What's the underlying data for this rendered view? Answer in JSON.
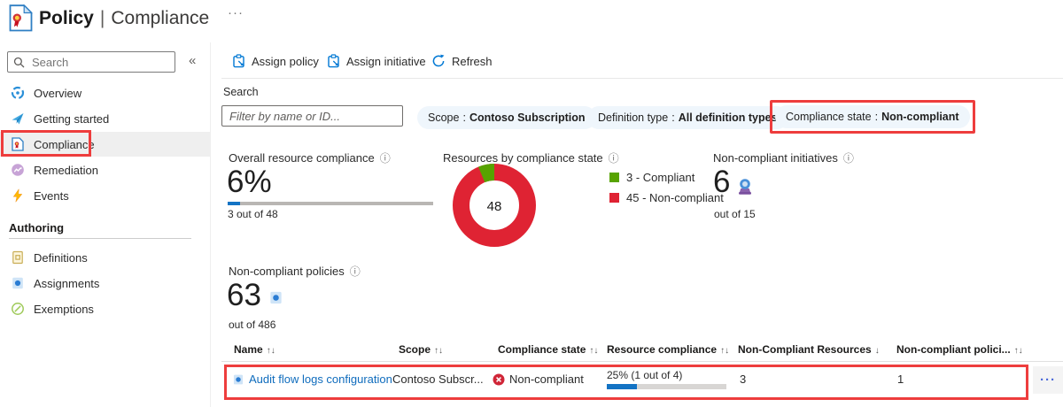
{
  "titlebar": {
    "primary": "Policy",
    "separator": "|",
    "secondary": "Compliance",
    "more": "···"
  },
  "sidebar": {
    "search_placeholder": "Search",
    "collapse": "«",
    "items": [
      {
        "label": "Overview"
      },
      {
        "label": "Getting started"
      },
      {
        "label": "Compliance"
      },
      {
        "label": "Remediation"
      },
      {
        "label": "Events"
      }
    ],
    "authoring": {
      "heading": "Authoring",
      "items": [
        {
          "label": "Definitions"
        },
        {
          "label": "Assignments"
        },
        {
          "label": "Exemptions"
        }
      ]
    }
  },
  "toolbar": {
    "buttons": [
      {
        "label": "Assign policy"
      },
      {
        "label": "Assign initiative"
      },
      {
        "label": "Refresh"
      }
    ]
  },
  "filters": {
    "search_label": "Search",
    "search_placeholder": "Filter by name or ID...",
    "separator": ":",
    "pills": [
      {
        "label": "Scope",
        "value": "Contoso Subscription"
      },
      {
        "label": "Definition type",
        "value": "All definition types"
      },
      {
        "label": "Compliance state",
        "value": "Non-compliant"
      }
    ]
  },
  "stats": {
    "info_icon": "ⓘ",
    "overall": {
      "title": "Overall resource compliance",
      "value": "6%",
      "percent": 6,
      "subtext": "3 out of 48"
    },
    "resources": {
      "title": "Resources by compliance state"
    },
    "initiatives": {
      "title": "Non-compliant initiatives",
      "value": "6",
      "subtext": "out of 15"
    },
    "policies": {
      "title": "Non-compliant policies",
      "value": "63",
      "subtext": "out of 486"
    }
  },
  "chart_data": {
    "type": "pie",
    "subtype": "donut",
    "title": "Resources by compliance state",
    "categories": [
      "Compliant",
      "Non-compliant"
    ],
    "values": [
      3,
      45
    ],
    "total": 48,
    "center_label": "48",
    "colors": [
      "#57a300",
      "#df2333"
    ],
    "legend": [
      {
        "label": "3 - Compliant",
        "color": "#57a300"
      },
      {
        "label": "45 - Non-compliant",
        "color": "#df2333"
      }
    ],
    "legend_position": "right"
  },
  "table": {
    "columns": [
      {
        "label": "Name",
        "sort": "↑↓"
      },
      {
        "label": "Scope",
        "sort": "↑↓"
      },
      {
        "label": "Compliance state",
        "sort": "↑↓"
      },
      {
        "label": "Resource compliance",
        "sort": "↑↓"
      },
      {
        "label": "Non-Compliant Resources",
        "sort": "↓"
      },
      {
        "label": "Non-compliant polici...",
        "sort": "↑↓"
      }
    ],
    "rows": [
      {
        "name": "Audit flow logs configuration",
        "scope": "Contoso Subscr...",
        "compliance_state": "Non-compliant",
        "resource_compliance": "25% (1 out of 4)",
        "resource_compliance_percent": 25,
        "non_compliant_resources": "3",
        "non_compliant_policies": "1",
        "more": "···"
      }
    ]
  },
  "colors": {
    "accent": "#0078d4",
    "annotation": "#ee3d3d",
    "pill_bg": "#eff6fc",
    "bar_blue": "#1373c4"
  }
}
